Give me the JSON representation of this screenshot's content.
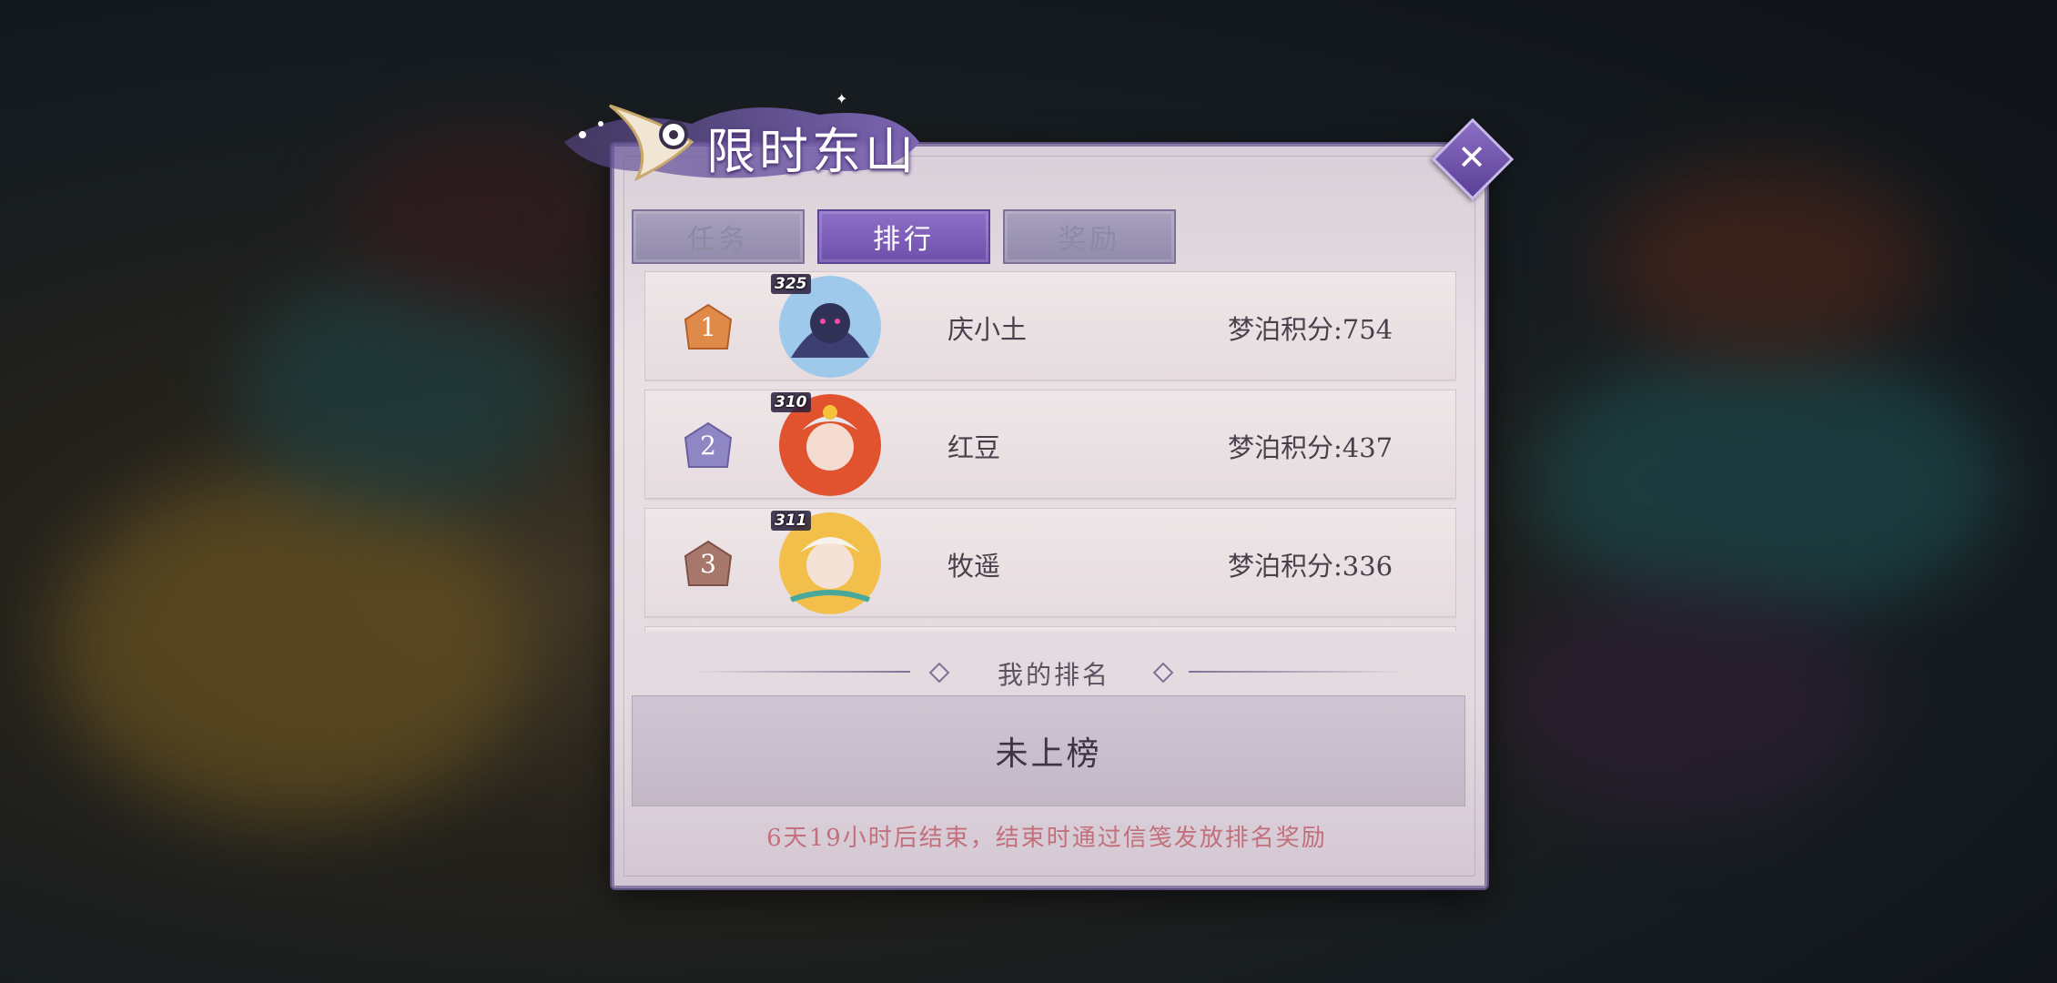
{
  "title": "限时东山",
  "tabs": [
    {
      "label": "任务",
      "active": false
    },
    {
      "label": "排行",
      "active": true
    },
    {
      "label": "奖励",
      "active": false
    }
  ],
  "ranking": [
    {
      "rank": "1",
      "level": "325",
      "name": "庆小土",
      "score": "梦泊积分:754",
      "badge_color": "#e08a4a"
    },
    {
      "rank": "2",
      "level": "310",
      "name": "红豆",
      "score": "梦泊积分:437",
      "badge_color": "#8f86c4"
    },
    {
      "rank": "3",
      "level": "311",
      "name": "牧遥",
      "score": "梦泊积分:336",
      "badge_color": "#a8776b"
    }
  ],
  "my_rank": {
    "title": "我的排名",
    "value": "未上榜"
  },
  "footer_note": "6天19小时后结束，结束时通过信笺发放排名奖励",
  "colors": {
    "accent": "#6e50ab",
    "panel": "#e6dde3",
    "note": "#c2707b"
  }
}
